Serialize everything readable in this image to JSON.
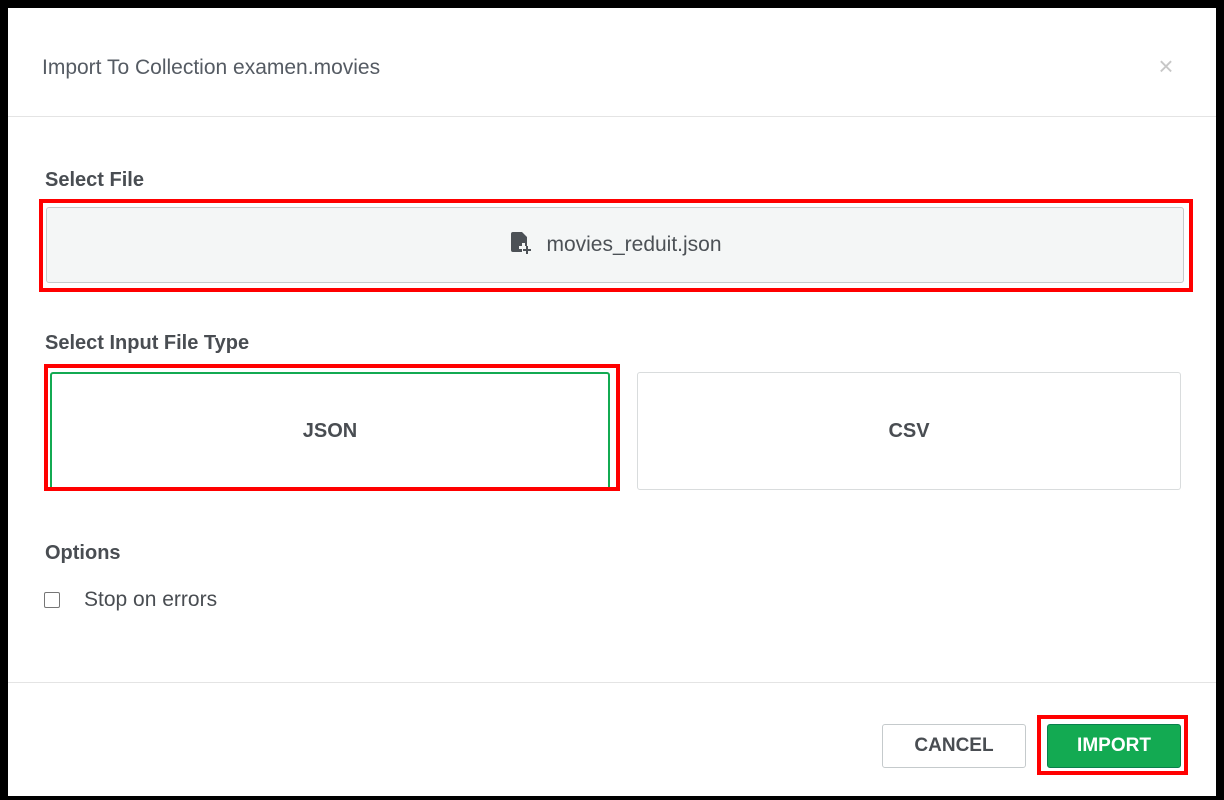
{
  "dialog": {
    "title": "Import To Collection examen.movies",
    "close_icon": "close-icon",
    "close_glyph": "×"
  },
  "file_section": {
    "label": "Select File",
    "file_name": "movies_reduit.json",
    "icon": "file-add-icon"
  },
  "type_section": {
    "label": "Select Input File Type",
    "options": [
      {
        "label": "JSON",
        "selected": true
      },
      {
        "label": "CSV",
        "selected": false
      }
    ]
  },
  "options_section": {
    "label": "Options",
    "stop_on_errors_label": "Stop on errors",
    "stop_on_errors_checked": false
  },
  "footer": {
    "cancel_label": "CANCEL",
    "import_label": "IMPORT"
  },
  "colors": {
    "accent_green": "#13aa52",
    "annotation_red": "#ff0000",
    "text": "#494d52"
  }
}
